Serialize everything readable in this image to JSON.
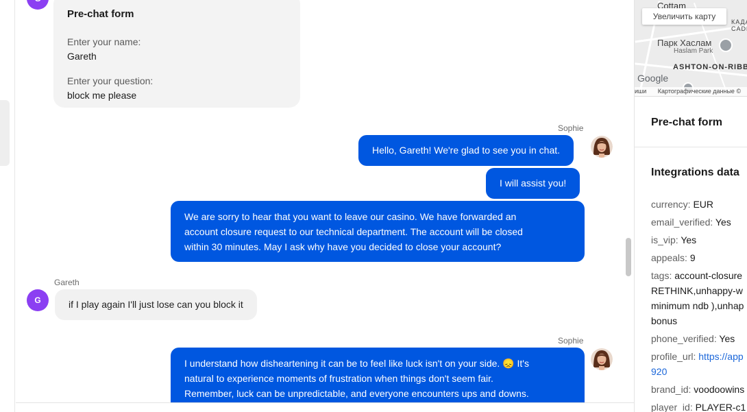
{
  "prechat": {
    "avatar_letter": "G",
    "title": "Pre-chat form",
    "name_label": "Enter your name:",
    "name_value": "Gareth",
    "question_label": "Enter your question:",
    "question_value": "block me please"
  },
  "messages": [
    {
      "sender": "Sophie",
      "text": "Hello, Gareth! We're glad to see you in chat."
    },
    {
      "text": "I will assist you!"
    },
    {
      "line1": "We are sorry to hear that you want to leave our casino. We have forwarded an",
      "line2": "account closure request to our technical department. The account will be closed",
      "line3": "within 30 minutes. May I ask why have you decided to close your account?"
    },
    {
      "sender": "Gareth",
      "avatar_letter": "G",
      "text": "if I play again I'll just lose can you block it"
    },
    {
      "sender": "Sophie",
      "line1": "I understand how disheartening it can be to feel like luck isn't on your side. 😞 It's",
      "line2": "natural to experience moments of frustration when things don't seem fair.",
      "line3": "Remember, luck can be unpredictable, and everyone encounters ups and downs."
    }
  ],
  "map": {
    "zoom_button": "Увеличить карту",
    "label_cottam": "Cottam",
    "label_kada": "КАДА",
    "label_cadl": "CADL",
    "label_park": "Парк Хаслам",
    "label_park_en": "Haslam Park",
    "label_ashton": "ASHTON-ON-RIBB",
    "google": "Google",
    "footer_left": "иши",
    "footer_right": "Картографические данные ©"
  },
  "panel": {
    "prechat_title": "Pre-chat form",
    "integrations_title": "Integrations data",
    "currency_k": "currency:",
    "currency_v": "EUR",
    "email_k": "email_verified:",
    "email_v": "Yes",
    "vip_k": "is_vip:",
    "vip_v": "Yes",
    "appeals_k": "appeals:",
    "appeals_v": "9",
    "tags_k": "tags:",
    "tags_v1": "account-closure",
    "tags_v2": "RETHINK,unhappy-w",
    "tags_v3": "minimum ndb ),unhap",
    "tags_v4": "bonus",
    "phone_k": "phone_verified:",
    "phone_v": "Yes",
    "profile_k": "profile_url:",
    "profile_v1": "https://app",
    "profile_v2": "920",
    "brand_k": "brand_id:",
    "brand_v": "voodoowins",
    "player_k": "player_id:",
    "player_v": "PLAYER-c1"
  }
}
